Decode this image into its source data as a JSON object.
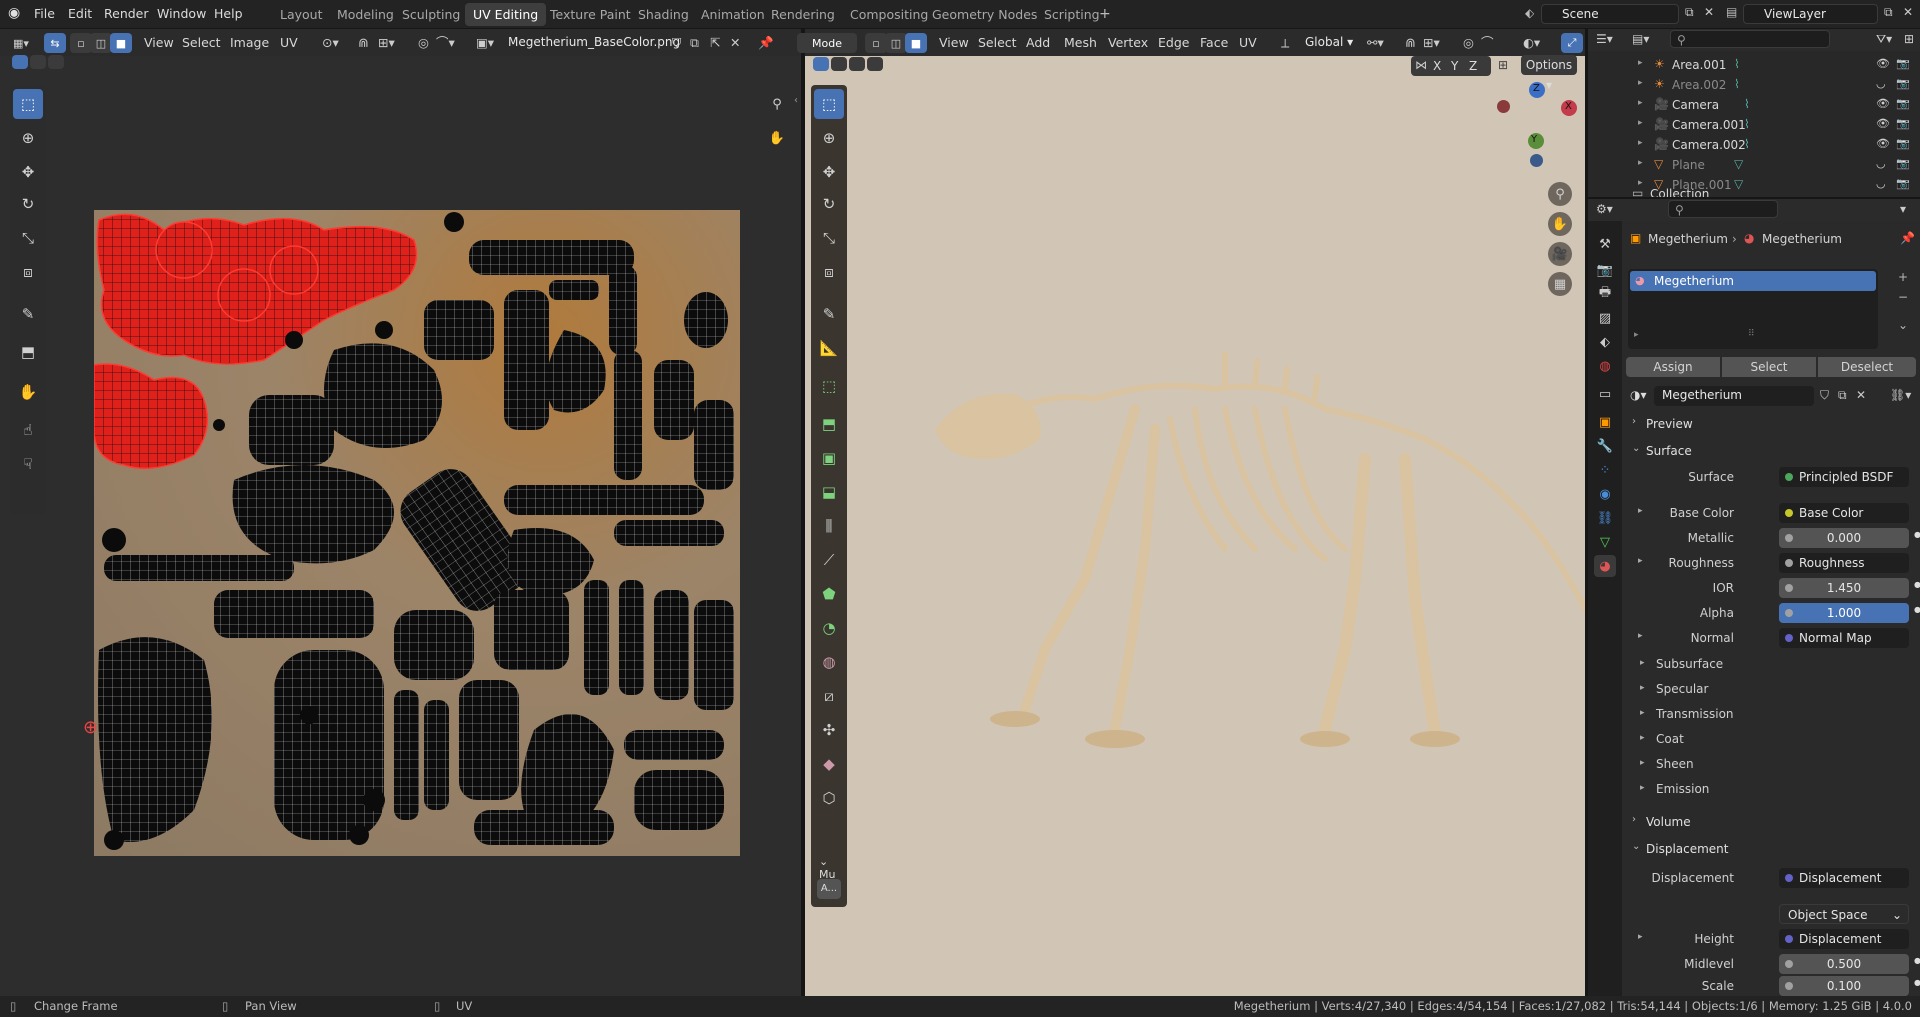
{
  "menu": {
    "file": "File",
    "edit": "Edit",
    "render": "Render",
    "window": "Window",
    "help": "Help"
  },
  "workspaces": [
    {
      "label": "Layout",
      "active": false
    },
    {
      "label": "Modeling",
      "active": false
    },
    {
      "label": "Sculpting",
      "active": false
    },
    {
      "label": "UV Editing",
      "active": true
    },
    {
      "label": "Texture Paint",
      "active": false
    },
    {
      "label": "Shading",
      "active": false
    },
    {
      "label": "Animation",
      "active": false
    },
    {
      "label": "Rendering",
      "active": false
    },
    {
      "label": "Compositing",
      "active": false
    },
    {
      "label": "Geometry Nodes",
      "active": false
    },
    {
      "label": "Scripting",
      "active": false
    }
  ],
  "add_workspace": "+",
  "scene": "Scene",
  "view_layer": "ViewLayer",
  "uv_header": {
    "view": "View",
    "select": "Select",
    "image": "Image",
    "uv": "UV",
    "image_name": "Megetherium_BaseColor.png"
  },
  "viewport_header": {
    "mode": "Mode",
    "view": "View",
    "select": "Select",
    "add": "Add",
    "mesh": "Mesh",
    "vertex": "Vertex",
    "edge": "Edge",
    "face": "Face",
    "uv": "UV",
    "orientation": "Global",
    "options": "Options",
    "x": "X",
    "y": "Y",
    "z": "Z"
  },
  "gizmo": {
    "x": "X",
    "y": "Y",
    "z": "Z"
  },
  "last_op": {
    "title": "Mu",
    "button": "A..."
  },
  "outliner": {
    "items": [
      {
        "name": "Area.001",
        "dim": false,
        "kind": "light"
      },
      {
        "name": "Area.002",
        "dim": true,
        "kind": "light"
      },
      {
        "name": "Camera",
        "dim": false,
        "kind": "camera"
      },
      {
        "name": "Camera.001",
        "dim": false,
        "kind": "camera"
      },
      {
        "name": "Camera.002",
        "dim": false,
        "kind": "camera"
      },
      {
        "name": "Plane",
        "dim": true,
        "kind": "mesh"
      },
      {
        "name": "Plane.001",
        "dim": true,
        "kind": "mesh"
      }
    ],
    "collection": "Collection"
  },
  "props": {
    "breadcrumb_object": "Megetherium",
    "breadcrumb_material": "Megetherium",
    "slot": "Megetherium",
    "assign": "Assign",
    "select": "Select",
    "deselect": "Deselect",
    "material_name": "Megetherium",
    "preview": "Preview",
    "surface_section": "Surface",
    "surface_label": "Surface",
    "surface_value": "Principled BSDF",
    "base_color_label": "Base Color",
    "base_color_value": "Base Color",
    "metallic_label": "Metallic",
    "metallic_value": "0.000",
    "roughness_label": "Roughness",
    "roughness_value": "Roughness",
    "ior_label": "IOR",
    "ior_value": "1.450",
    "alpha_label": "Alpha",
    "alpha_value": "1.000",
    "normal_label": "Normal",
    "normal_value": "Normal Map",
    "subsurface": "Subsurface",
    "specular": "Specular",
    "transmission": "Transmission",
    "coat": "Coat",
    "sheen": "Sheen",
    "emission": "Emission",
    "volume": "Volume",
    "displacement_section": "Displacement",
    "displacement_label": "Displacement",
    "displacement_value": "Displacement",
    "space": "Object Space",
    "height_label": "Height",
    "height_value": "Displacement",
    "midlevel_label": "Midlevel",
    "midlevel_value": "0.500",
    "scale_label": "Scale",
    "scale_value": "0.100"
  },
  "status": {
    "change_frame": "Change Frame",
    "pan_view": "Pan View",
    "uv": "UV",
    "stats": "Megetherium | Verts:4/27,340 | Edges:4/54,154 | Faces:1/27,082 | Tris:54,144 | Objects:1/6 | Memory: 1.25 GiB | 4.0.0"
  },
  "colors": {
    "accent": "#4772b3",
    "selected_uv": "#e0201b",
    "texture": "#9c8468",
    "viewport_bg": "#d1c6b6",
    "bone": "#d9c3a0"
  }
}
